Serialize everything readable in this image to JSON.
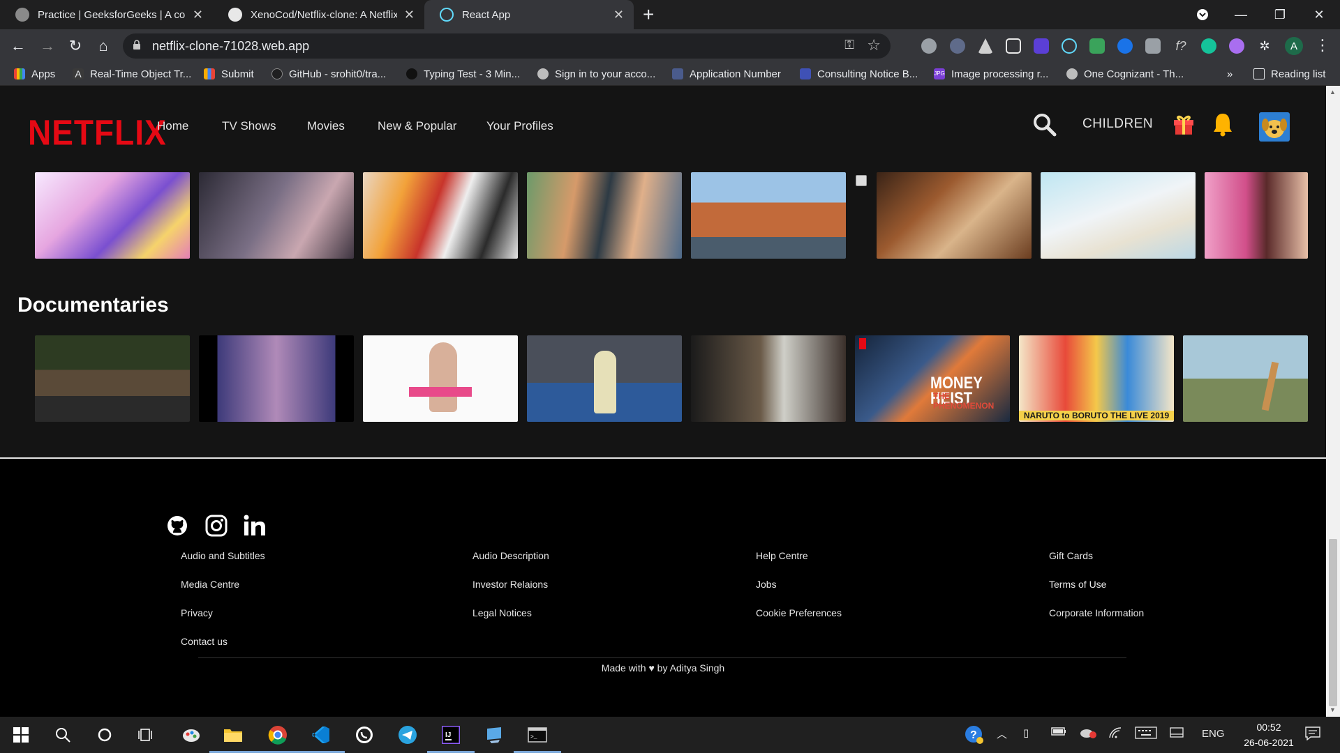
{
  "browser": {
    "tabs": [
      {
        "title": "Practice | GeeksforGeeks | A com",
        "active": false
      },
      {
        "title": "XenoCod/Netflix-clone: A Netflix",
        "active": false
      },
      {
        "title": "React App",
        "active": true
      }
    ],
    "url": "netflix-clone-71028.web.app",
    "profile_initial": "A",
    "bookmarks": [
      "Apps",
      "Real-Time Object Tr...",
      "Submit",
      "GitHub - srohit0/tra...",
      "Typing Test - 3 Min...",
      "Sign in to your acco...",
      "Application Number",
      "Consulting Notice B...",
      "Image processing r...",
      "One Cognizant - Th..."
    ],
    "bookmarks_overflow": "»",
    "reading_list": "Reading list"
  },
  "netflix": {
    "logo": "NETFLIX",
    "nav": [
      "Home",
      "TV Shows",
      "Movies",
      "New & Popular",
      "Your Profiles"
    ],
    "profile_label": "CHILDREN",
    "rows": [
      {
        "title": ""
      },
      {
        "title": "Documentaries"
      }
    ]
  },
  "footer": {
    "social_icons": [
      "github-icon",
      "instagram-icon",
      "linkedin-icon"
    ],
    "columns": [
      [
        "Audio and Subtitles",
        "Media Centre",
        "Privacy",
        "Contact us"
      ],
      [
        "Audio Description",
        "Investor Relaions",
        "Legal Notices"
      ],
      [
        "Help Centre",
        "Jobs",
        "Cookie Preferences"
      ],
      [
        "Gift Cards",
        "Terms of Use",
        "Corporate Information"
      ]
    ],
    "credit": "Made with ♥ by Aditya Singh"
  },
  "taskbar": {
    "language": "ENG",
    "time": "00:52",
    "date": "26-06-2021"
  },
  "colors": {
    "netflix_red": "#e50914",
    "page_bg": "#141414",
    "footer_bg": "#000000"
  }
}
